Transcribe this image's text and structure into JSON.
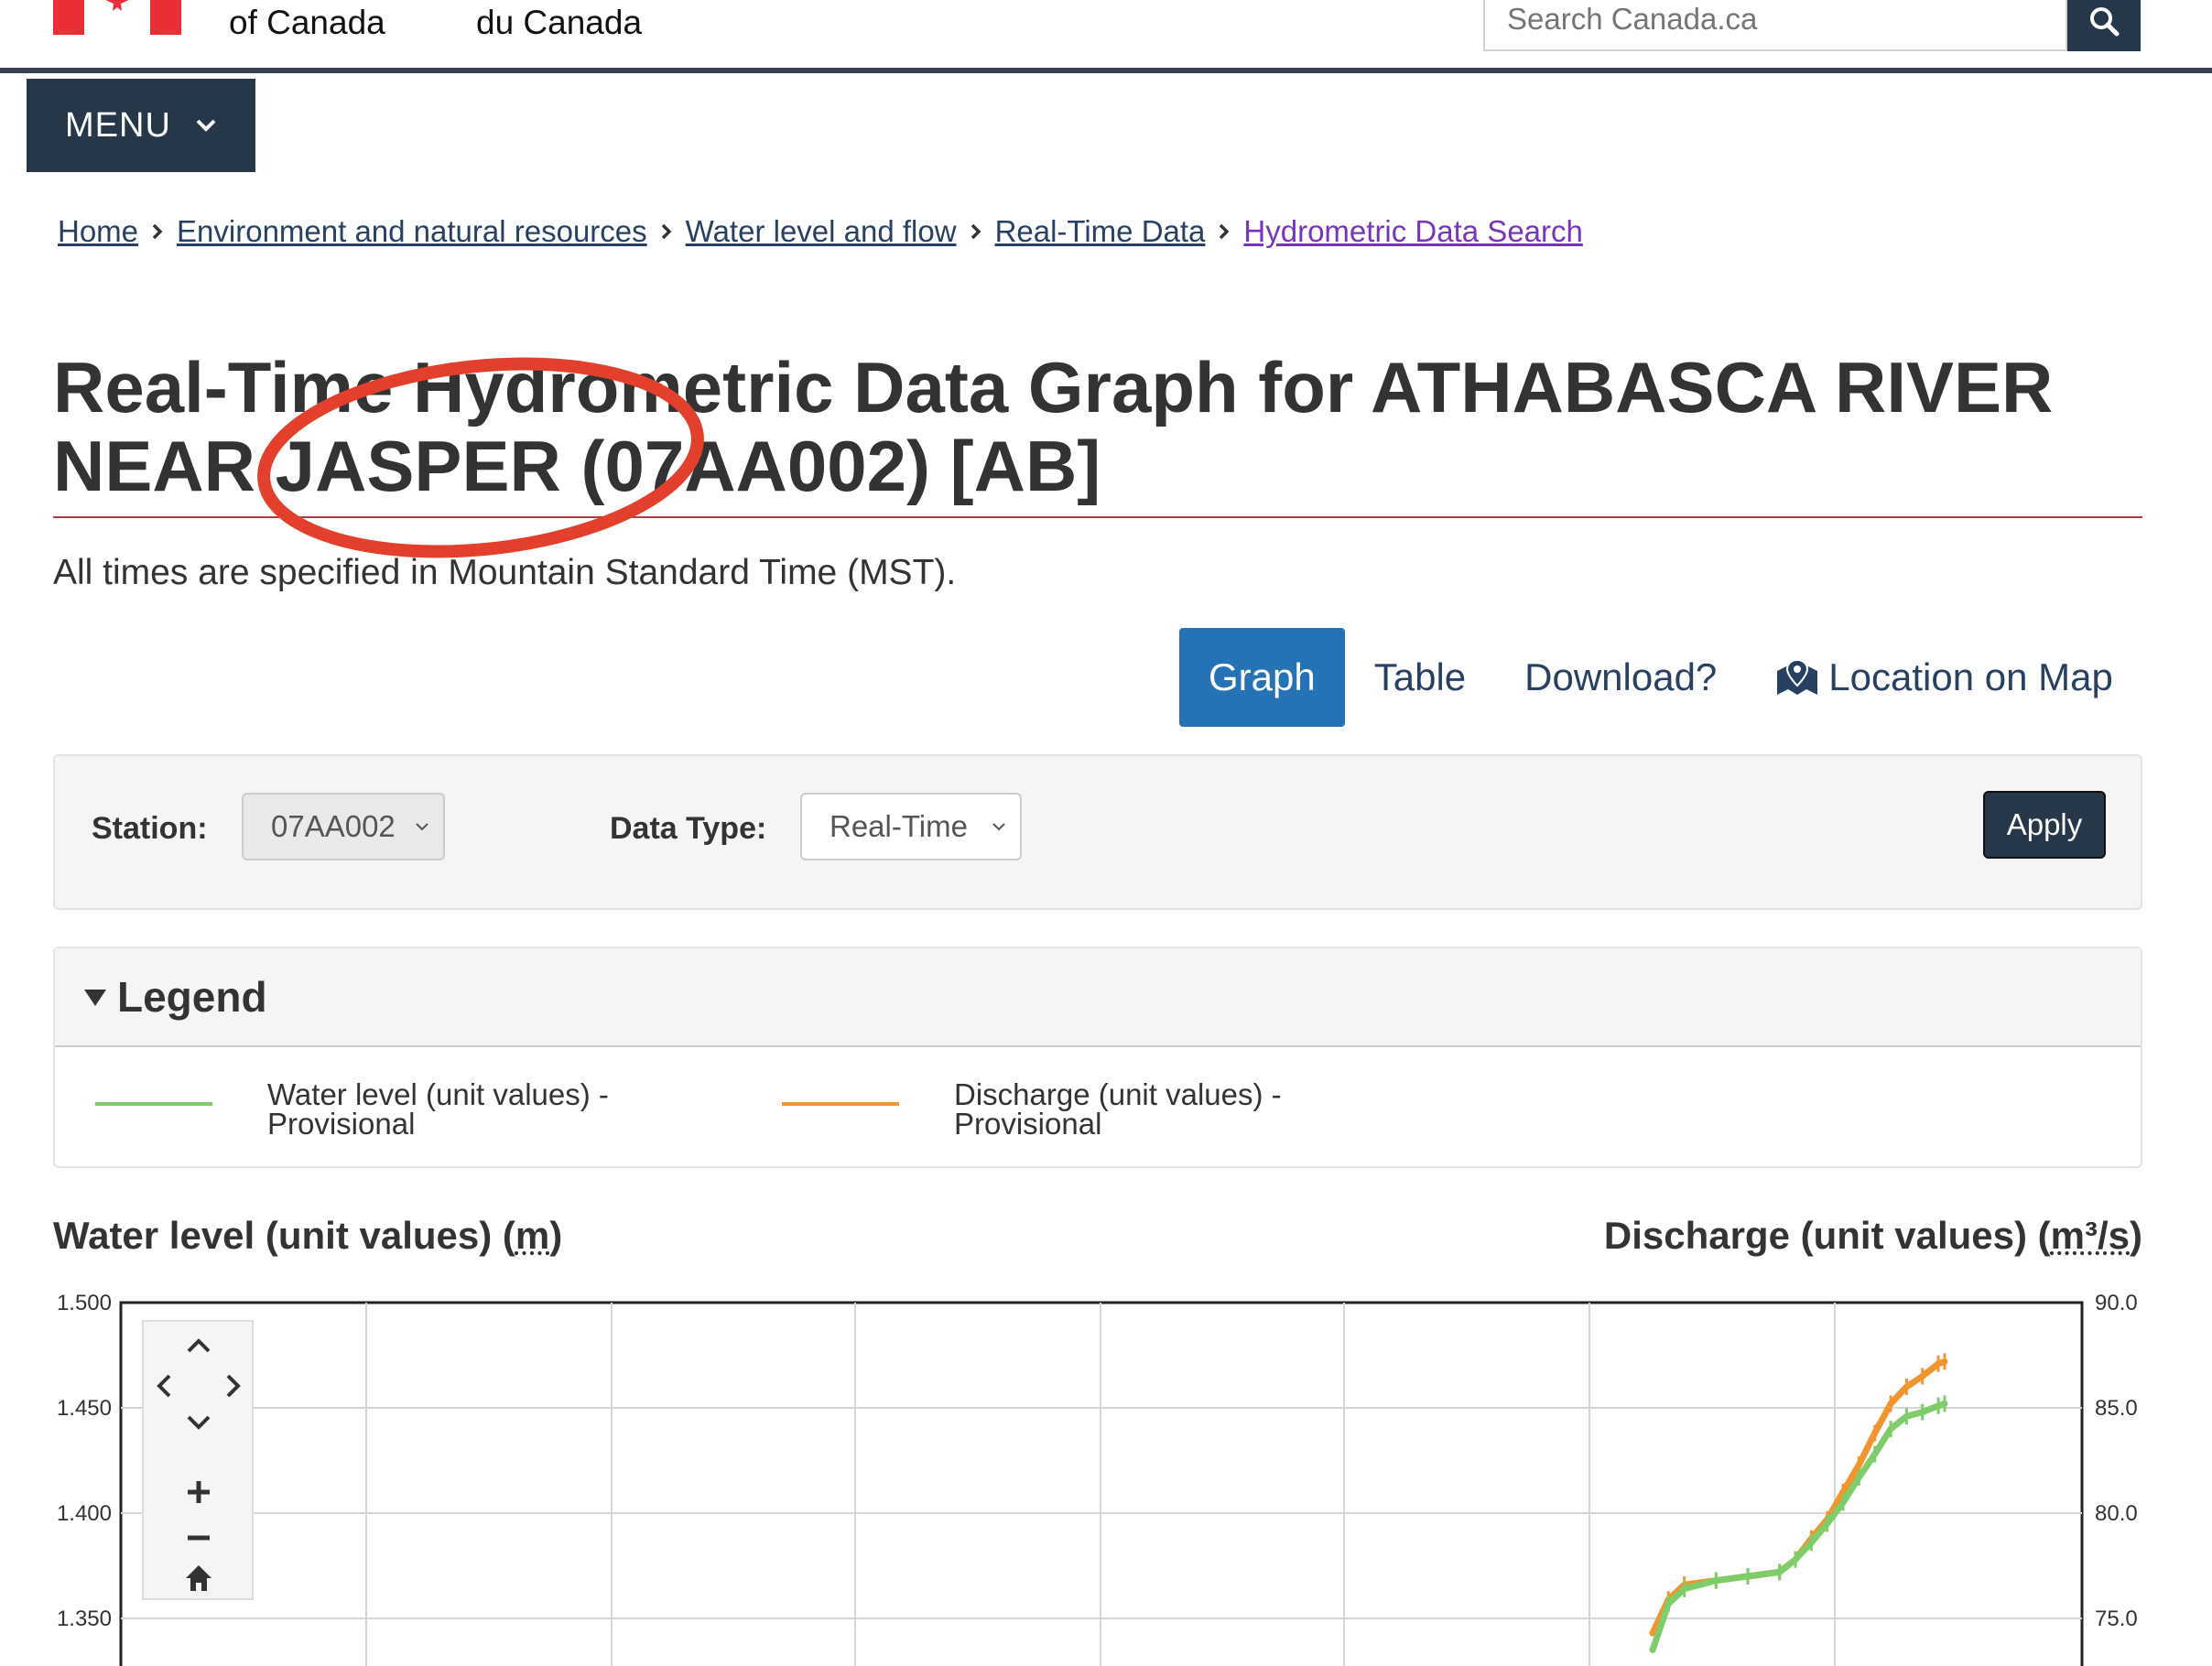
{
  "header": {
    "gov_en": "of Canada",
    "gov_fr": "du Canada",
    "search_placeholder": "Search Canada.ca"
  },
  "menu": {
    "label": "MENU"
  },
  "breadcrumb": [
    {
      "label": "Home"
    },
    {
      "label": "Environment and natural resources"
    },
    {
      "label": "Water level and flow"
    },
    {
      "label": "Real-Time Data"
    },
    {
      "label": "Hydrometric Data Search"
    }
  ],
  "page": {
    "title": "Real-Time Hydrometric Data Graph for ATHABASCA RIVER NEAR JASPER (07AA002) [AB]",
    "tz_note": "All times are specified in Mountain Standard Time (MST)."
  },
  "tabs": [
    {
      "label": "Graph",
      "active": true
    },
    {
      "label": "Table"
    },
    {
      "label": "Download?"
    },
    {
      "label": "Location on Map",
      "icon": "map-marker-icon"
    }
  ],
  "filters": {
    "station_label": "Station:",
    "station_value": "07AA002",
    "datatype_label": "Data Type:",
    "datatype_value": "Real-Time",
    "apply_label": "Apply"
  },
  "legend": {
    "title": "Legend",
    "items": [
      {
        "label": "Water level (unit values) - Provisional",
        "color": "#7fcc6a"
      },
      {
        "label": "Discharge (unit values) - Provisional",
        "color": "#f2952e"
      }
    ]
  },
  "chart_titles": {
    "left_prefix": "Water level (unit values) (",
    "left_unit": "m",
    "right_prefix": "Discharge (unit values) (",
    "right_unit": "m³/s"
  },
  "chart_data": {
    "type": "line",
    "y_left": {
      "ticks": [
        "1.500",
        "1.450",
        "1.400",
        "1.350"
      ],
      "range": [
        1.5,
        1.35
      ]
    },
    "y_right": {
      "ticks": [
        "90.0",
        "85.0",
        "80.0",
        "75.0"
      ],
      "range": [
        90.0,
        75.0
      ]
    },
    "series": [
      {
        "name": "Water level (unit values) - Provisional",
        "color": "#7fcc6a",
        "points": [
          [
            0.0,
            1.335
          ],
          [
            0.05,
            1.357
          ],
          [
            0.1,
            1.364
          ],
          [
            0.2,
            1.368
          ],
          [
            0.3,
            1.37
          ],
          [
            0.4,
            1.372
          ],
          [
            0.45,
            1.378
          ],
          [
            0.5,
            1.386
          ],
          [
            0.55,
            1.395
          ],
          [
            0.6,
            1.405
          ],
          [
            0.65,
            1.417
          ],
          [
            0.7,
            1.428
          ],
          [
            0.75,
            1.44
          ],
          [
            0.8,
            1.446
          ],
          [
            0.85,
            1.448
          ],
          [
            0.9,
            1.451
          ],
          [
            0.92,
            1.452
          ]
        ]
      },
      {
        "name": "Discharge (unit values) - Provisional",
        "color": "#f2952e",
        "points": [
          [
            0.0,
            74.3
          ],
          [
            0.05,
            75.9
          ],
          [
            0.1,
            76.6
          ],
          [
            0.2,
            76.8
          ],
          [
            0.3,
            77.0
          ],
          [
            0.4,
            77.2
          ],
          [
            0.45,
            77.8
          ],
          [
            0.5,
            78.8
          ],
          [
            0.55,
            79.7
          ],
          [
            0.6,
            81.0
          ],
          [
            0.65,
            82.3
          ],
          [
            0.7,
            83.8
          ],
          [
            0.75,
            85.2
          ],
          [
            0.8,
            86.0
          ],
          [
            0.85,
            86.5
          ],
          [
            0.9,
            87.1
          ],
          [
            0.92,
            87.2
          ]
        ]
      }
    ]
  }
}
